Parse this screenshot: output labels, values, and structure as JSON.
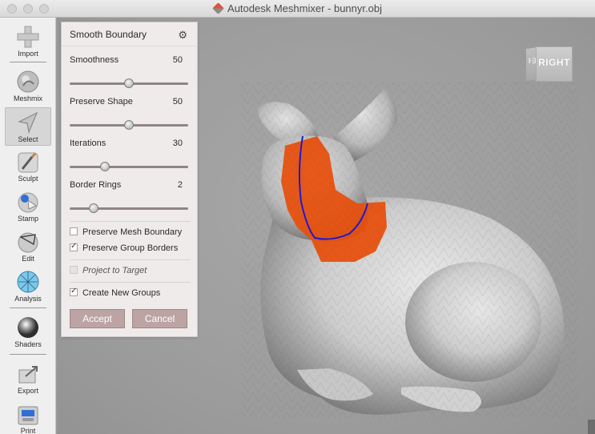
{
  "window": {
    "title": "Autodesk Meshmixer - bunnyr.obj"
  },
  "toolbar": {
    "items": [
      {
        "label": "Import",
        "icon": "plus-icon"
      },
      {
        "label": "Meshmix",
        "icon": "meshmix-icon"
      },
      {
        "label": "Select",
        "icon": "select-arrow-icon",
        "selected": true
      },
      {
        "label": "Sculpt",
        "icon": "brush-icon"
      },
      {
        "label": "Stamp",
        "icon": "stamp-icon"
      },
      {
        "label": "Edit",
        "icon": "edit-icon"
      },
      {
        "label": "Analysis",
        "icon": "analysis-icon"
      },
      {
        "label": "Shaders",
        "icon": "sphere-icon"
      },
      {
        "label": "Export",
        "icon": "export-icon"
      },
      {
        "label": "Print",
        "icon": "printer-icon"
      }
    ]
  },
  "panel": {
    "title": "Smooth Boundary",
    "params": [
      {
        "label": "Smoothness",
        "value": "50",
        "fraction": 0.5
      },
      {
        "label": "Preserve Shape",
        "value": "50",
        "fraction": 0.5
      },
      {
        "label": "Iterations",
        "value": "30",
        "fraction": 0.3
      },
      {
        "label": "Border Rings",
        "value": "2",
        "fraction": 0.2
      }
    ],
    "checks": [
      {
        "label": "Preserve Mesh Boundary",
        "checked": false
      },
      {
        "label": "Preserve Group Borders",
        "checked": true
      },
      {
        "label": "Project to Target",
        "checked": false,
        "disabled": true
      },
      {
        "label": "Create New Groups",
        "checked": true
      }
    ],
    "accept_label": "Accept",
    "cancel_label": "Cancel"
  },
  "viewport": {
    "navcube_label": "RIGHT",
    "navcube_side_label": "ŀƎ",
    "selection_color": "#e8500e",
    "boundary_color": "#1b1bd0"
  }
}
